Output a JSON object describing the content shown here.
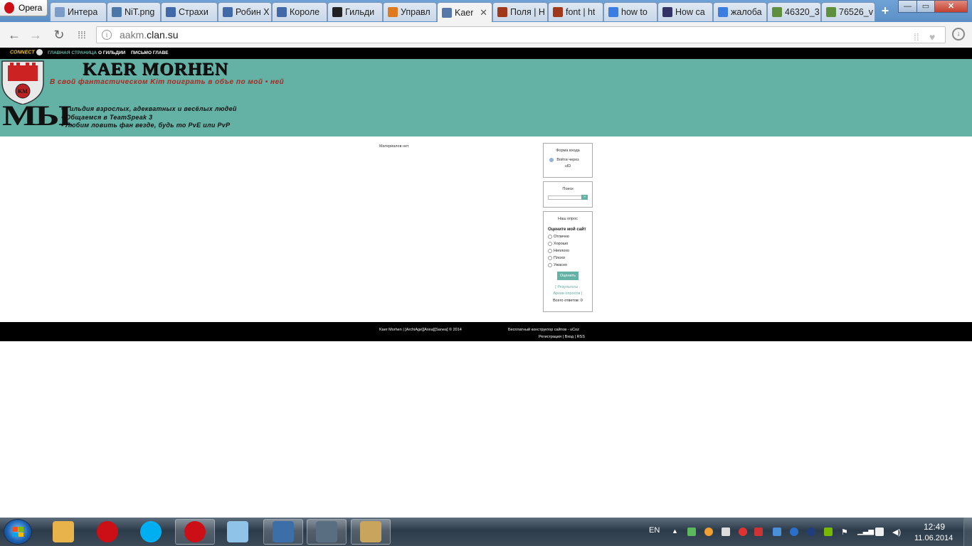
{
  "browser": {
    "menu_label": "Opera",
    "tabs": [
      {
        "title": "Интера",
        "icon_color": "#7b9cc9"
      },
      {
        "title": "NiT.png",
        "icon_color": "#4a76a8"
      },
      {
        "title": "Страхи",
        "icon_color": "#4169a8"
      },
      {
        "title": "Робин Х",
        "icon_color": "#4169a8"
      },
      {
        "title": "Короле",
        "icon_color": "#4169a8"
      },
      {
        "title": "Гильди",
        "icon_color": "#222222"
      },
      {
        "title": "Управл",
        "icon_color": "#e07a1f"
      },
      {
        "title": "Kaer",
        "icon_color": "#5577aa"
      },
      {
        "title": "Поля | H",
        "icon_color": "#a0381c"
      },
      {
        "title": "font | ht",
        "icon_color": "#a0381c"
      },
      {
        "title": "how to",
        "icon_color": "#3b7de0"
      },
      {
        "title": "How ca",
        "icon_color": "#333366"
      },
      {
        "title": "жалоба",
        "icon_color": "#3b7de0"
      },
      {
        "title": "46320_3",
        "icon_color": "#5e8f3e"
      },
      {
        "title": "76526_v",
        "icon_color": "#5e8f3e"
      }
    ],
    "active_tab_index": 7,
    "tab_close_glyph": "✕",
    "new_tab_glyph": "+",
    "window_buttons": {
      "minimize": "—",
      "maximize": "▭",
      "close": "✕"
    },
    "url_prefix": "aakm.",
    "url_domain": "clan.su"
  },
  "site": {
    "connect_logo": "CONNECT",
    "nav": [
      "ГЛАВНАЯ СТРАНИЦА",
      "О ГИЛЬДИИ",
      "ПИСЬМО ГЛАВЕ"
    ],
    "title": "KAER MORHEN",
    "subtitle": "В свой фантастическом Kim поиграть в объе по мой • ней",
    "we": "МЫ",
    "features": [
      "• Гильдия взрослых, адекватных и весёлых людей",
      "• Общаемся в TeamSpeak 3",
      "• Любим ловить фан везде, будь то PvE или PvP"
    ],
    "no_materials": "Материалов нет",
    "login": {
      "title": "Форма входа",
      "openid_line1": "Войти через",
      "openid_line2": "uID"
    },
    "search": {
      "title": "Поиск",
      "button": "»"
    },
    "poll": {
      "title": "Наш опрос",
      "question": "Оцените мой сайт",
      "options": [
        "Отлично",
        "Хорошо",
        "Неплохо",
        "Плохо",
        "Ужасно"
      ],
      "vote_button": "Оценить",
      "results_link": "[ Результаты ·",
      "archive_link": "Архив опросов ]",
      "total": "Всего ответов: 0"
    },
    "footer": {
      "copyright": "Kaer Morhen | [ArchiAge][Anna][Sanea] © 2014",
      "ucoz": "Бесплатный конструктор сайтов - uCoz",
      "links": "Регистрация | Вход | RSS"
    }
  },
  "taskbar": {
    "apps": [
      {
        "name": "explorer",
        "color": "#e8b34a",
        "open": false
      },
      {
        "name": "opera",
        "color": "#cc0f16",
        "open": false
      },
      {
        "name": "skype",
        "color": "#00aff0",
        "open": false
      },
      {
        "name": "opera-active",
        "color": "#cc0f16",
        "open": true
      },
      {
        "name": "notepad",
        "color": "#8fc4e8",
        "open": false
      },
      {
        "name": "photo-viewer",
        "color": "#3c6fa8",
        "open": true
      },
      {
        "name": "teamspeak",
        "color": "#5a6e82",
        "open": true
      },
      {
        "name": "paint",
        "color": "#c9a45c",
        "open": true
      }
    ],
    "language": "EN",
    "time": "12:49",
    "date": "11.06.2014"
  }
}
